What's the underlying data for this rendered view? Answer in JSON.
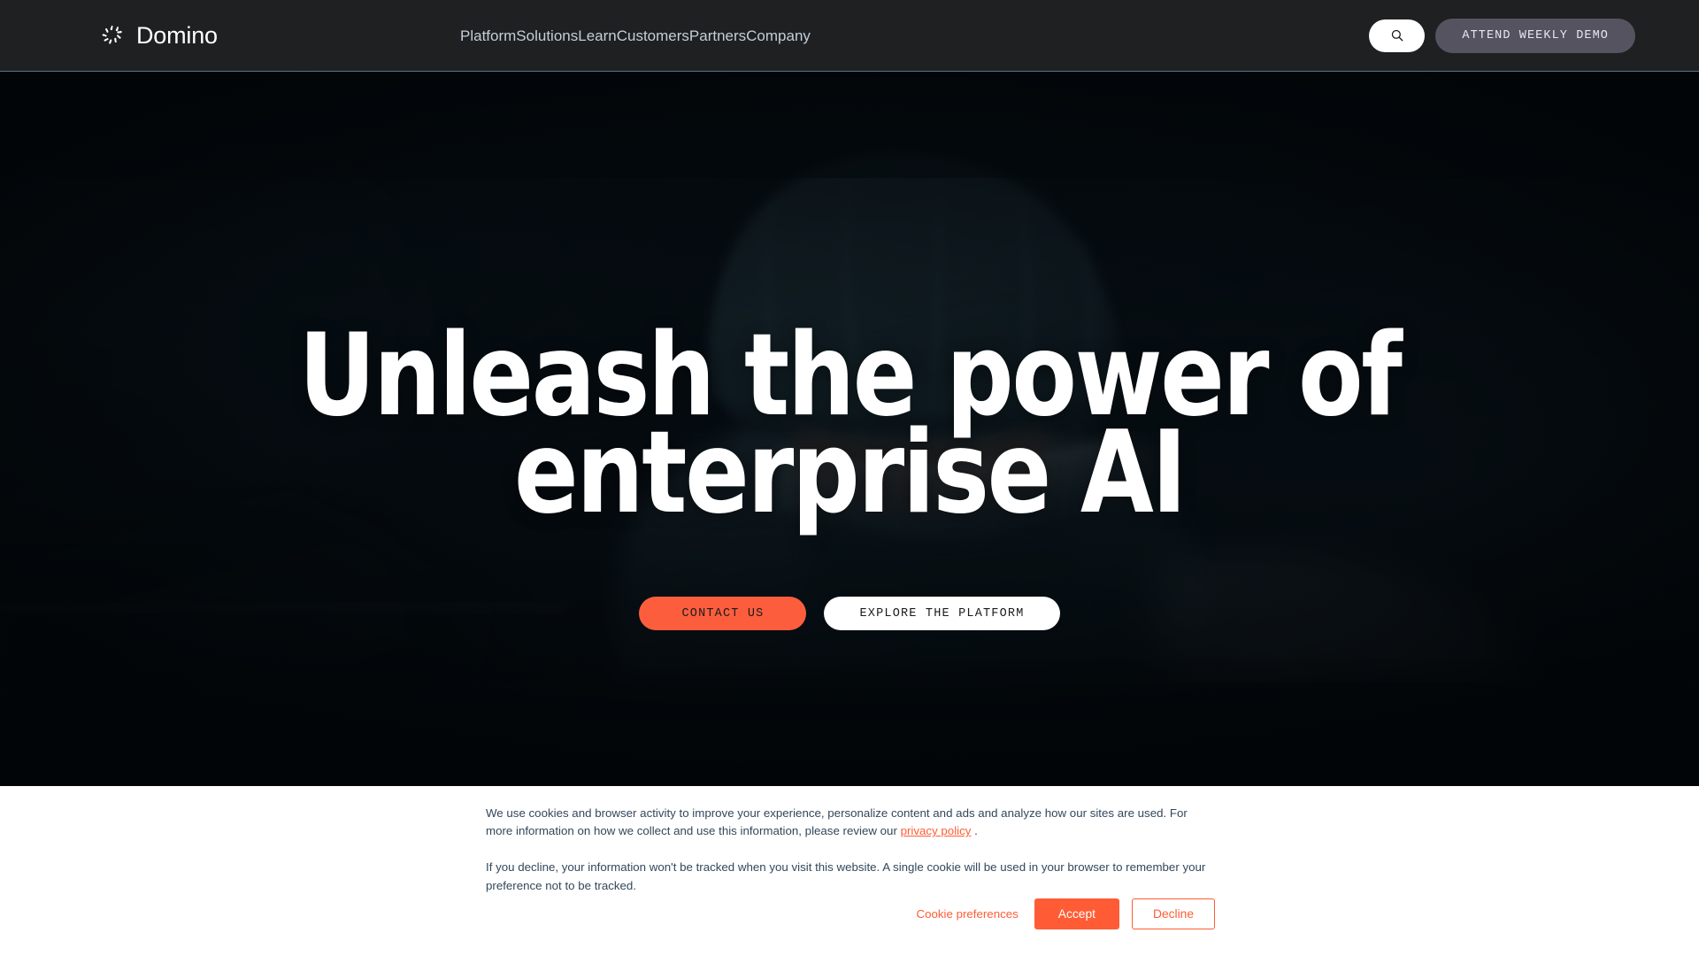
{
  "header": {
    "brand": {
      "name": "Domino",
      "logo_icon": "domino-aperture-logo"
    },
    "nav": [
      {
        "label": "Platform"
      },
      {
        "label": "Solutions"
      },
      {
        "label": "Learn"
      },
      {
        "label": "Customers"
      },
      {
        "label": "Partners"
      },
      {
        "label": "Company"
      }
    ],
    "search": {
      "icon": "search-icon",
      "aria": "Search"
    },
    "demo_button": {
      "label": "ATTEND WEEKLY DEMO"
    },
    "colors": {
      "background": "#1e2021",
      "nav_text": "#c3cedb",
      "demo_bg": "#565361",
      "border": "#5b718c"
    }
  },
  "hero": {
    "title_line_1": "Unleash the power of",
    "title_line_2": "enterprise AI",
    "primary_cta": {
      "label": "CONTACT US"
    },
    "secondary_cta": {
      "label": "EXPLORE THE PLATFORM"
    },
    "background_description": "Dark teal-toned photo of a surgeon in scrubs, cap and safety glasses",
    "colors": {
      "accent": "#fc5e3d",
      "title": "#ffffff",
      "backdrop": "#05090d"
    }
  },
  "cookie_banner": {
    "paragraph_1_before_link": "We use cookies and browser activity to improve your experience, personalize content and ads and analyze how our sites are used. For more information on how we collect and use this information, please review our ",
    "privacy_link_label": "privacy policy",
    "paragraph_1_after_link": " .",
    "paragraph_2": "If you decline, your information won't be tracked when you visit this website. A single cookie will be used in your browser to remember your preference not to be tracked.",
    "preferences_label": "Cookie preferences",
    "accept_label": "Accept",
    "decline_label": "Decline",
    "colors": {
      "accent": "#ff5c35",
      "text": "#33475b",
      "background": "#ffffff"
    }
  }
}
